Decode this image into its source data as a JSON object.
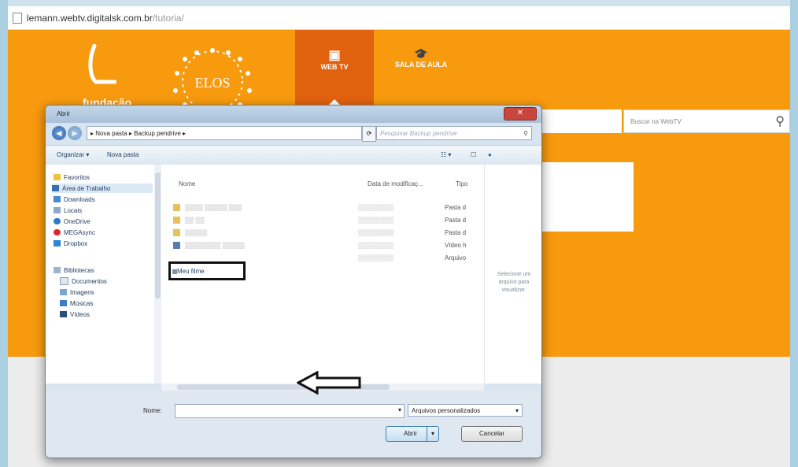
{
  "browser": {
    "url_host": "lemann.webtv.digitalsk.com.br",
    "url_path": "/tutoria/"
  },
  "site": {
    "logo_text": "fundação",
    "elos_text": "ELOS",
    "nav": [
      {
        "label": "WEB TV",
        "icon": "tv-icon",
        "active": true
      },
      {
        "label": "SALA DE AULA",
        "icon": "graduation-cap-icon",
        "active": false
      }
    ],
    "search_placeholder": "Buscar na WebTV",
    "accent": "#f89a0e",
    "nav_active": "#e0620f"
  },
  "dialog": {
    "title": "Abrir",
    "breadcrumb": "▸ Nova pasta ▸ Backup pendrive ▸",
    "search_placeholder": "Pesquisar Backup pendrive",
    "toolbar": {
      "organize": "Organizar ▾",
      "new_folder": "Nova pasta"
    },
    "nav_items": [
      {
        "label": "Favoritos",
        "icon": "star-icon"
      },
      {
        "label": "Área de Trabalho",
        "icon": "desktop-icon"
      },
      {
        "label": "Downloads",
        "icon": "downloads-icon"
      },
      {
        "label": "Locais",
        "icon": "places-icon"
      },
      {
        "label": "OneDrive",
        "icon": "cloud-icon"
      },
      {
        "label": "MEGAsync",
        "icon": "mega-icon"
      },
      {
        "label": "Dropbox",
        "icon": "dropbox-icon"
      },
      {
        "label": "Bibliotecas",
        "icon": "library-icon"
      },
      {
        "label": "Documentos",
        "icon": "documents-icon"
      },
      {
        "label": "Imagens",
        "icon": "images-icon"
      },
      {
        "label": "Músicas",
        "icon": "music-icon"
      },
      {
        "label": "Vídeos",
        "icon": "videos-icon"
      }
    ],
    "columns": {
      "name": "Nome",
      "date": "Data de modificaç...",
      "type": "Tipo"
    },
    "files": [
      {
        "type": "Pasta d",
        "icon": "folder-icon"
      },
      {
        "type": "Pasta d",
        "icon": "folder-icon"
      },
      {
        "type": "Pasta d",
        "icon": "folder-icon"
      },
      {
        "type": "Vídeo h",
        "icon": "video-file-icon"
      },
      {
        "type": "Arquivo",
        "icon": "file-icon"
      }
    ],
    "highlighted_file": "Meu filme",
    "preview_text": "Selecione um arquivo para visualizar.",
    "filename_label": "Nome:",
    "filetype": "Arquivos personalizados",
    "open_label": "Abrir",
    "cancel_label": "Cancelar"
  }
}
